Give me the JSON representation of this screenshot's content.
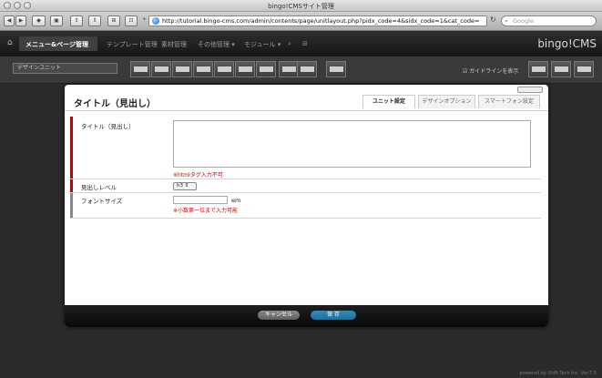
{
  "window": {
    "title": "bingo!CMSサイト管理"
  },
  "browser": {
    "url": "http://tutorial.bingo-cms.com/admin/contents/page/unitlayout.php?pidx_code=4&sidx_code=1&cat_code=",
    "search_placeholder": "Google"
  },
  "nav": {
    "items": [
      "メニュー&ページ管理",
      "テンプレート管理",
      "素材管理",
      "その他管理 ▾",
      "モジュール ▾"
    ],
    "brand": "bingo!CMS"
  },
  "toolbar": {
    "unit_select": "デザインユニット",
    "guide_label": "ガイドラインを表示"
  },
  "modal": {
    "title": "タイトル（見出し）",
    "tabs": [
      "ユニット設定",
      "デザインオプション",
      "スマートフォン設定"
    ],
    "fields": {
      "title": {
        "label": "タイトル（見出し）",
        "value": "",
        "note": "※htmlタグ入力不可"
      },
      "level": {
        "label": "見出しレベル",
        "value": "h3"
      },
      "font_size": {
        "label": "フォントサイズ",
        "value": "",
        "unit": "em",
        "note": "※小数第一位まで入力可能"
      }
    },
    "buttons": {
      "cancel": "キャンセル",
      "save": "保 存"
    },
    "colors": {
      "required_bar": "#c00000",
      "optional_bar": "#888888",
      "save_button": "#1e6f9a"
    }
  },
  "footer": {
    "credit": "powered by Shift Tech Inc. Ver.7.5"
  }
}
